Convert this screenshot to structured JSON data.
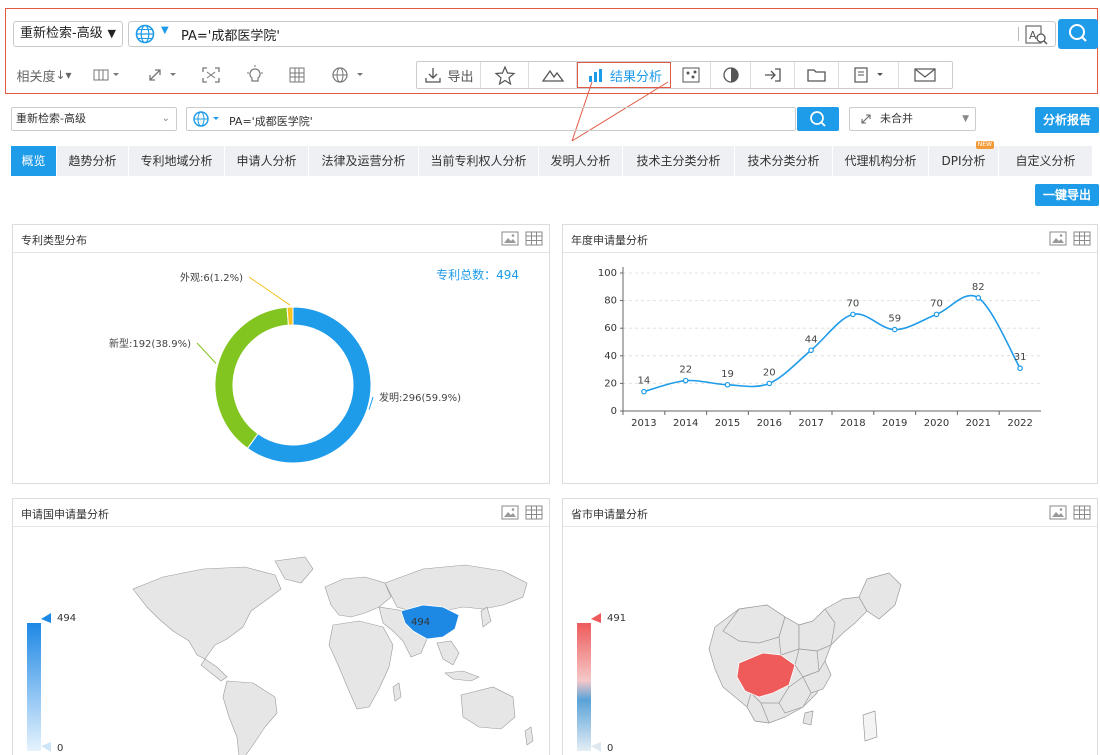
{
  "callout": {
    "mode_select": "重新检索-高级",
    "query": "PA='成都医学院'",
    "sort_label": "相关度",
    "export_label": "导出",
    "result_analysis_label": "结果分析"
  },
  "search": {
    "mode_select": "重新检索-高级",
    "query": "PA='成都医学院'",
    "merge_label": "未合并",
    "report_label": "分析报告"
  },
  "tabs": [
    {
      "label": "概览",
      "active": true
    },
    {
      "label": "趋势分析"
    },
    {
      "label": "专利地域分析"
    },
    {
      "label": "申请人分析"
    },
    {
      "label": "法律及运营分析"
    },
    {
      "label": "当前专利权人分析"
    },
    {
      "label": "发明人分析"
    },
    {
      "label": "技术主分类分析"
    },
    {
      "label": "技术分类分析"
    },
    {
      "label": "代理机构分析"
    },
    {
      "label": "DPI分析",
      "badge": "NEW"
    },
    {
      "label": "自定义分析"
    }
  ],
  "export_all_label": "一键导出",
  "panels": {
    "type": {
      "title": "专利类型分布",
      "total_label": "专利总数：494"
    },
    "year": {
      "title": "年度申请量分析"
    },
    "country": {
      "title": "申请国申请量分析"
    },
    "province": {
      "title": "省市申请量分析"
    }
  },
  "chart_data": [
    {
      "type": "pie",
      "title": "专利类型分布",
      "slices": [
        {
          "name": "发明",
          "value": 296,
          "pct": "59.9%",
          "label": "发明:296(59.9%)",
          "color": "#1e9be9"
        },
        {
          "name": "新型",
          "value": 192,
          "pct": "38.9%",
          "label": "新型:192(38.9%)",
          "color": "#82c520"
        },
        {
          "name": "外观",
          "value": 6,
          "pct": "1.2%",
          "label": "外观:6(1.2%)",
          "color": "#f5c222"
        }
      ],
      "total": 494
    },
    {
      "type": "line",
      "title": "年度申请量分析",
      "x": [
        "2013",
        "2014",
        "2015",
        "2016",
        "2017",
        "2018",
        "2019",
        "2020",
        "2021",
        "2022"
      ],
      "values": [
        14,
        22,
        19,
        20,
        44,
        70,
        59,
        70,
        82,
        31
      ],
      "ylim": [
        0,
        100
      ],
      "yticks": [
        0,
        20,
        40,
        60,
        80,
        100
      ],
      "grid": true,
      "color": "#1e9be9"
    },
    {
      "type": "heatmap",
      "title": "申请国申请量分析",
      "highlight": "China",
      "value": 494,
      "scale": {
        "max": "494",
        "min": "0"
      },
      "color": "#1e88e5"
    },
    {
      "type": "heatmap",
      "title": "省市申请量分析",
      "highlight": "Sichuan",
      "value": 491,
      "scale": {
        "max": "491",
        "min": "0"
      },
      "color": "#ef5b5b"
    }
  ]
}
